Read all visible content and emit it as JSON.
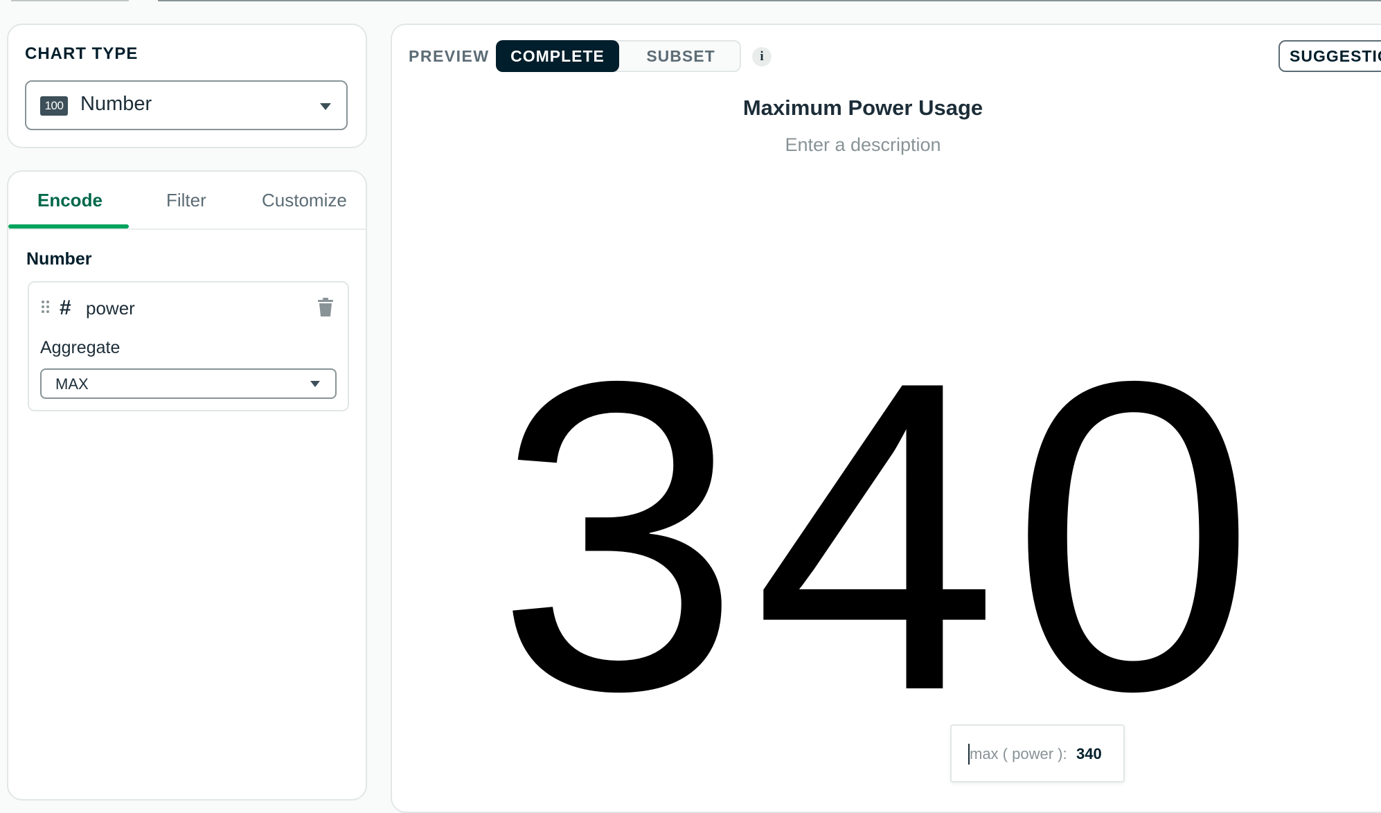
{
  "sidebar": {
    "chart_type": {
      "heading": "CHART TYPE",
      "badge": "100",
      "selected": "Number"
    },
    "tabs": [
      {
        "label": "Encode",
        "active": true
      },
      {
        "label": "Filter",
        "active": false
      },
      {
        "label": "Customize",
        "active": false
      }
    ],
    "encode": {
      "channel": "Number",
      "field": {
        "type_icon": "hash-icon",
        "name": "power"
      },
      "aggregate_label": "Aggregate",
      "aggregate_value": "MAX"
    }
  },
  "preview": {
    "label": "PREVIEW",
    "modes": [
      "COMPLETE",
      "SUBSET"
    ],
    "active_mode": "COMPLETE",
    "suggestions_button": "SUGGESTIONS",
    "chart_title": "Maximum Power Usage",
    "description_placeholder": "Enter a description",
    "number_value": "340",
    "tooltip": {
      "key": "max ( power ):",
      "value": "340"
    }
  },
  "colors": {
    "accent_green": "#00a35c",
    "active_tab_text": "#00684a",
    "dark_button": "#001e2b"
  }
}
